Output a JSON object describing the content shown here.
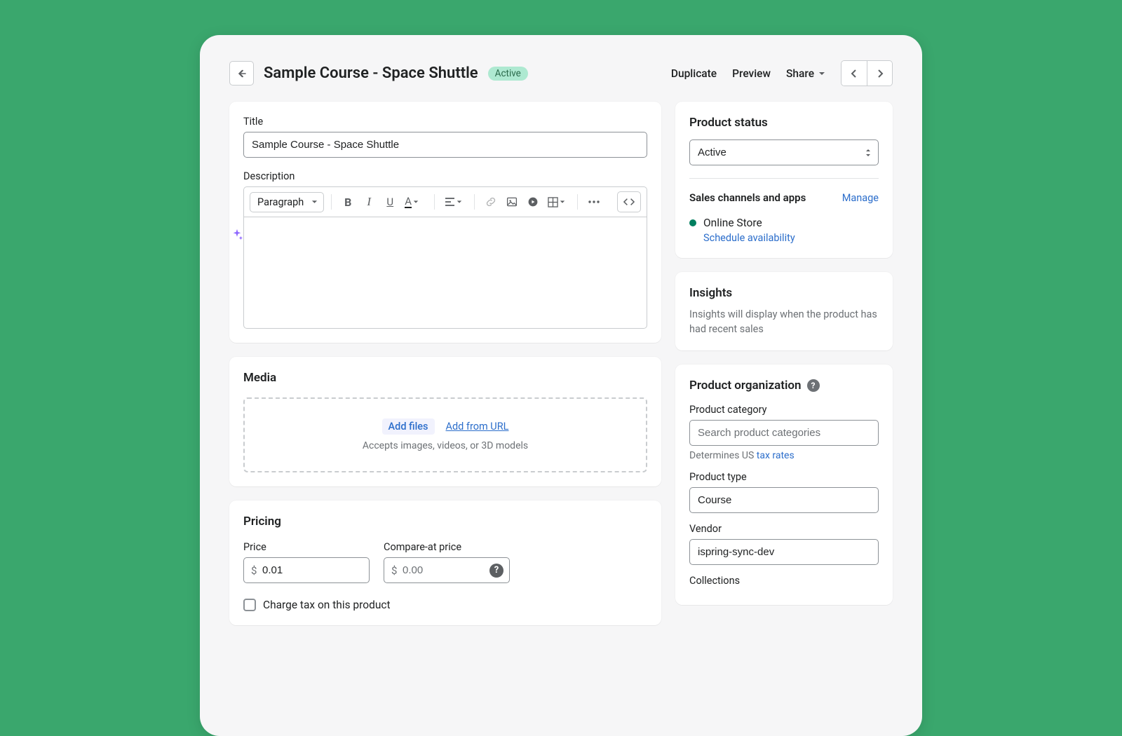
{
  "header": {
    "title": "Sample Course - Space Shuttle",
    "status_badge": "Active",
    "duplicate": "Duplicate",
    "preview": "Preview",
    "share": "Share"
  },
  "title_block": {
    "label": "Title",
    "value": "Sample Course - Space Shuttle"
  },
  "description": {
    "label": "Description",
    "style_label": "Paragraph"
  },
  "media": {
    "heading": "Media",
    "add_files": "Add files",
    "add_from_url": "Add from URL",
    "hint": "Accepts images, videos, or 3D models"
  },
  "pricing": {
    "heading": "Pricing",
    "price_label": "Price",
    "price_value": "0.01",
    "compare_label": "Compare-at price",
    "compare_value": "0.00",
    "currency": "$",
    "charge_tax": "Charge tax on this product"
  },
  "status": {
    "heading": "Product status",
    "value": "Active",
    "channels_heading": "Sales channels and apps",
    "manage": "Manage",
    "channel_name": "Online Store",
    "schedule": "Schedule availability"
  },
  "insights": {
    "heading": "Insights",
    "body": "Insights will display when the product has had recent sales"
  },
  "organization": {
    "heading": "Product organization",
    "category_label": "Product category",
    "category_placeholder": "Search product categories",
    "tax_prefix": "Determines US ",
    "tax_link": "tax rates",
    "type_label": "Product type",
    "type_value": "Course",
    "vendor_label": "Vendor",
    "vendor_value": "ispring-sync-dev",
    "collections_label": "Collections"
  }
}
